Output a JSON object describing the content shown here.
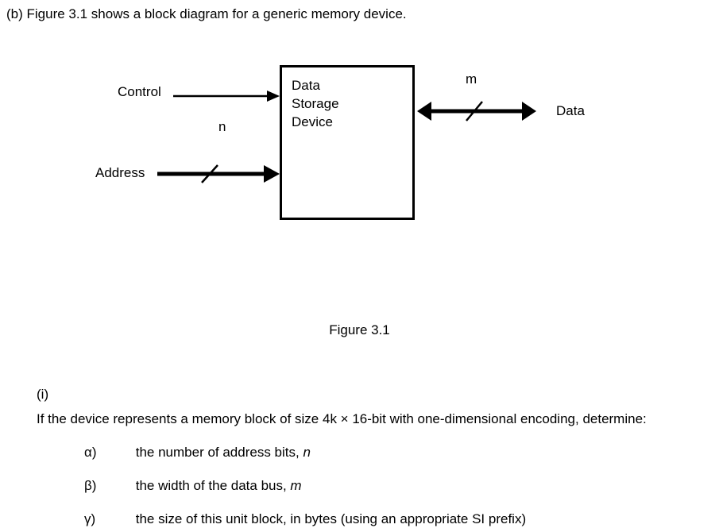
{
  "intro": {
    "num": "(b)",
    "text": "Figure 3.1 shows a block diagram for a generic memory device."
  },
  "diagram": {
    "control_label": "Control",
    "address_label": "Address",
    "data_label": "Data",
    "n_label": "n",
    "m_label": "m",
    "box_line1": "Data",
    "box_line2": "Storage",
    "box_line3": "Device",
    "caption": "Figure 3.1"
  },
  "question": {
    "num": "(i)",
    "lead": "If the device represents a memory block of size 4k × 16-bit with one-dimensional encoding, determine:",
    "alpha": {
      "sym": "α)",
      "text_pre": "the number of address bits, ",
      "var": "n"
    },
    "beta": {
      "sym": "β)",
      "text_pre": "the width of the data bus, ",
      "var": "m"
    },
    "gamma": {
      "sym": "γ)",
      "text": "the size of this unit block, in bytes (using an appropriate SI prefix)"
    }
  }
}
